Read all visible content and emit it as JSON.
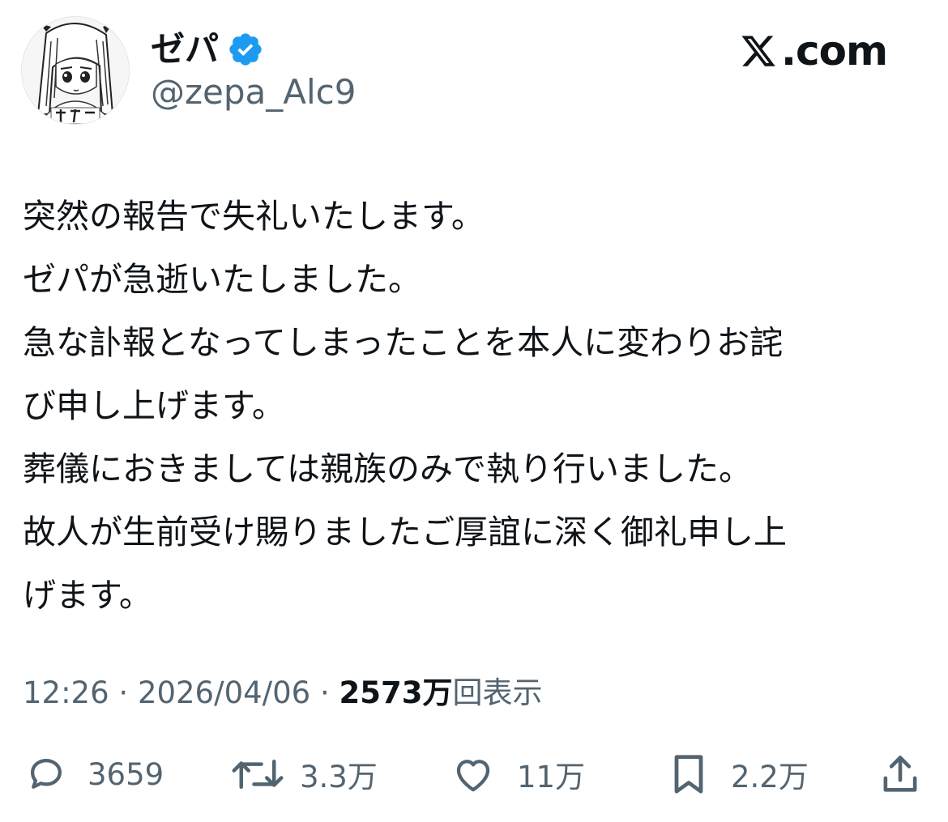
{
  "author": {
    "display_name": "ゼパ",
    "handle": "@zepa_Alc9",
    "verified_icon": "verified-badge-icon",
    "avatar_icon": "avatar-drawing"
  },
  "site": {
    "brand_text": ".com",
    "logo_icon": "x-logo-icon"
  },
  "tweet": {
    "lines": [
      "突然の報告で失礼いたします。",
      "ゼパが急逝いたしました。",
      "急な訃報となってしまったことを本人に変わりお詫",
      "び申し上げます。",
      "葬儀におきましては親族のみで執り行いました。",
      "故人が生前受け賜りましたご厚誼に深く御礼申し上",
      "げます。"
    ]
  },
  "meta": {
    "time": "12:26",
    "separator": "·",
    "date": "2026/04/06",
    "views_count": "2573万",
    "views_label": "回表示"
  },
  "actions": {
    "replies": "3659",
    "reposts": "3.3万",
    "likes": "11万",
    "bookmarks": "2.2万"
  },
  "colors": {
    "text_primary": "#0f1419",
    "text_secondary": "#536471",
    "verified_blue": "#1d9bf0",
    "background": "#ffffff"
  }
}
